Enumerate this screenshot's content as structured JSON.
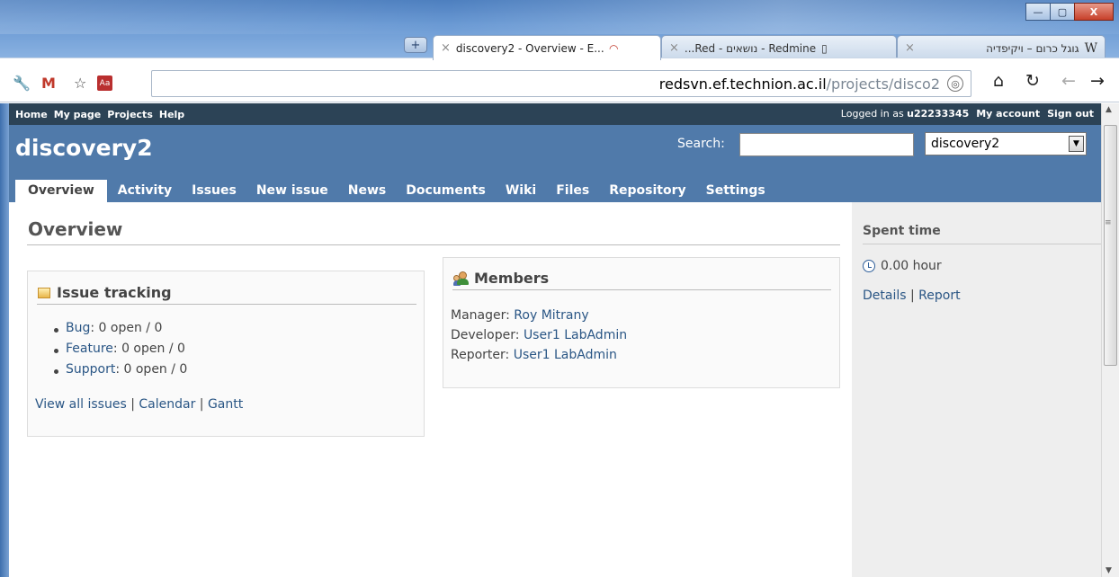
{
  "browser": {
    "tabs": [
      {
        "title": "discovery2 - Overview - E...",
        "favicon": "redmine-icon",
        "active": true
      },
      {
        "title": "...Red - נושאים - Redmine",
        "favicon": "page-icon",
        "active": false
      },
      {
        "title": "גוגל כרום – ויקיפדיה",
        "favicon": "wikipedia-icon",
        "active": false
      }
    ],
    "new_tab_label": "+",
    "close_tab_glyph": "×",
    "wiki_glyph": "W",
    "url_host": "redsvn.ef.technion.ac.il",
    "url_path": "/projects/disco2",
    "window_buttons": {
      "minimize": "—",
      "maximize": "▢",
      "close": "X"
    }
  },
  "top_menu": {
    "items": [
      "Home",
      "My page",
      "Projects",
      "Help"
    ],
    "logged_in_prefix": "Logged in as",
    "username": "u22233345",
    "my_account": "My account",
    "sign_out": "Sign out"
  },
  "header": {
    "project_title": "discovery2",
    "search_label": "Search:",
    "search_value": "",
    "project_select_value": "discovery2"
  },
  "main_menu": {
    "tabs": [
      "Overview",
      "Activity",
      "Issues",
      "New issue",
      "News",
      "Documents",
      "Wiki",
      "Files",
      "Repository",
      "Settings"
    ],
    "selected": "Overview"
  },
  "content": {
    "title": "Overview",
    "issue_tracking": {
      "heading": "Issue tracking",
      "trackers": [
        {
          "name": "Bug",
          "text": ": 0 open / 0"
        },
        {
          "name": "Feature",
          "text": ": 0 open / 0"
        },
        {
          "name": "Support",
          "text": ": 0 open / 0"
        }
      ],
      "links": [
        "View all issues",
        "Calendar",
        "Gantt"
      ],
      "separator": " | "
    },
    "members": {
      "heading": "Members",
      "rows": [
        {
          "role": "Manager: ",
          "name": "Roy Mitrany"
        },
        {
          "role": "Developer: ",
          "name": "User1 LabAdmin"
        },
        {
          "role": "Reporter: ",
          "name": "User1 LabAdmin"
        }
      ]
    }
  },
  "sidebar": {
    "spent_time_title": "Spent time",
    "hours": "0.00 hour",
    "details": "Details",
    "report": "Report",
    "separator": " | "
  },
  "colors": {
    "header_bg": "#507aaa",
    "top_menu_bg": "#2c4356",
    "link": "#2a5685",
    "sidebar_bg": "#eeeeee"
  }
}
